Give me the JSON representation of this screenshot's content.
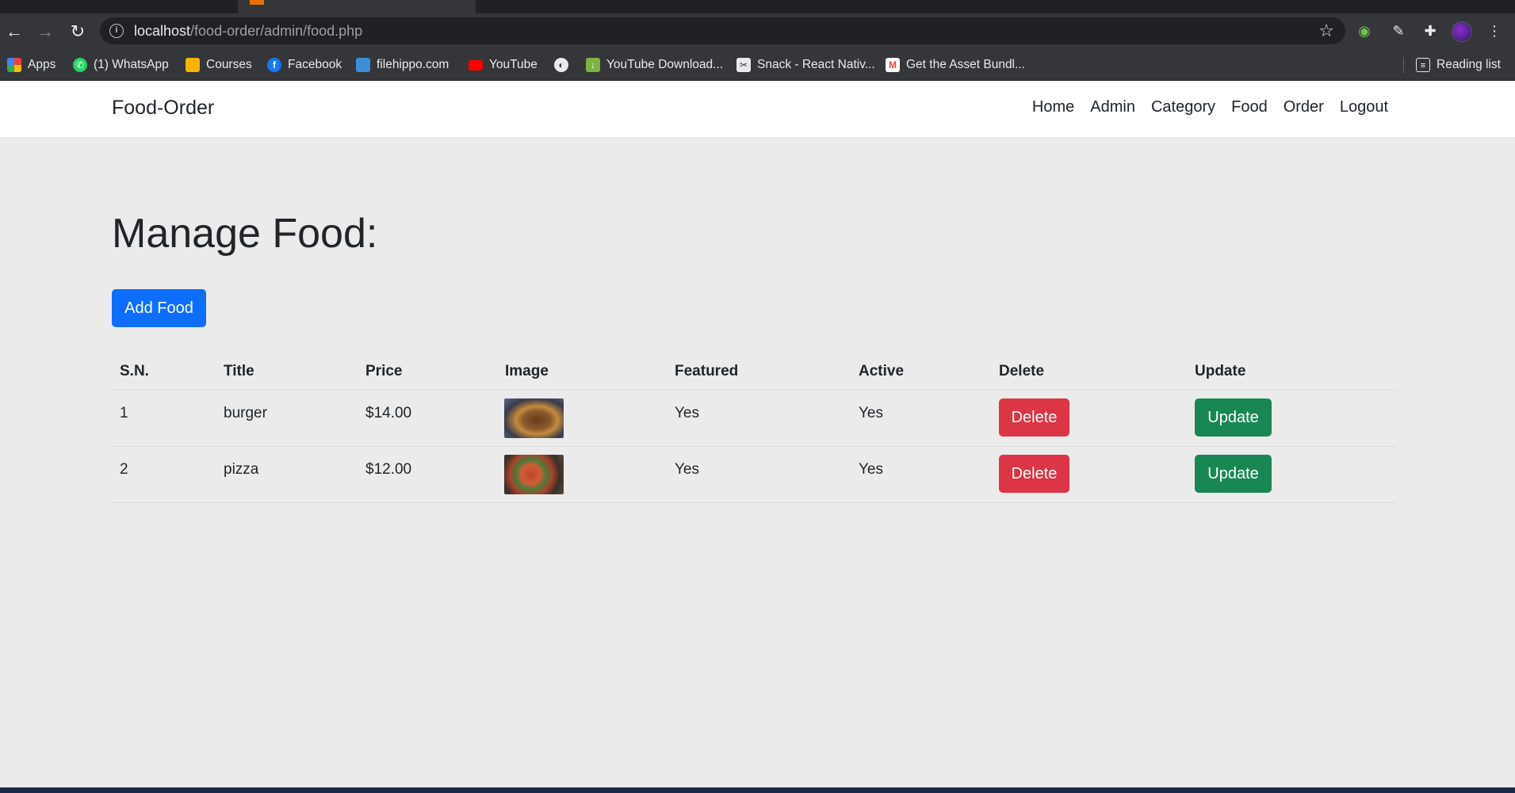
{
  "browser": {
    "url_host": "localhost",
    "url_path": "/food-order/admin/food.php",
    "bookmarks": [
      {
        "label": "Apps",
        "icon": "apps-grid-icon",
        "color": "#ea4335"
      },
      {
        "label": "(1) WhatsApp",
        "icon": "whatsapp-icon",
        "color": "#25d366"
      },
      {
        "label": "Courses",
        "icon": "classroom-icon",
        "color": "#f4b400"
      },
      {
        "label": "Facebook",
        "icon": "facebook-icon",
        "color": "#1877f2"
      },
      {
        "label": "filehippo.com",
        "icon": "filehippo-icon",
        "color": "#3b8fd6"
      },
      {
        "label": "YouTube",
        "icon": "youtube-icon",
        "color": "#ff0000"
      },
      {
        "label": "",
        "icon": "globe-icon",
        "color": "#e8eaed"
      },
      {
        "label": "YouTube Download...",
        "icon": "download-arrow-icon",
        "color": "#7cb342"
      },
      {
        "label": "Snack - React Nativ...",
        "icon": "snack-icon",
        "color": "#e8eaed"
      },
      {
        "label": "Get the Asset Bundl...",
        "icon": "gmail-icon",
        "color": "#ea4335"
      }
    ],
    "reading_list": "Reading list"
  },
  "nav": {
    "brand": "Food-Order",
    "links": [
      "Home",
      "Admin",
      "Category",
      "Food",
      "Order",
      "Logout"
    ]
  },
  "page": {
    "title": "Manage Food:",
    "add_button": "Add Food"
  },
  "table": {
    "headers": [
      "S.N.",
      "Title",
      "Price",
      "Image",
      "Featured",
      "Active",
      "Delete",
      "Update"
    ],
    "rows": [
      {
        "sn": "1",
        "title": "burger",
        "price": "$14.00",
        "image": "burger-photo",
        "featured": "Yes",
        "active": "Yes",
        "delete": "Delete",
        "update": "Update"
      },
      {
        "sn": "2",
        "title": "pizza",
        "price": "$12.00",
        "image": "pizza-photo",
        "featured": "Yes",
        "active": "Yes",
        "delete": "Delete",
        "update": "Update"
      }
    ]
  },
  "colors": {
    "primary": "#0d6efd",
    "danger": "#dc3545",
    "success": "#198754",
    "page_bg": "#ebebeb"
  }
}
